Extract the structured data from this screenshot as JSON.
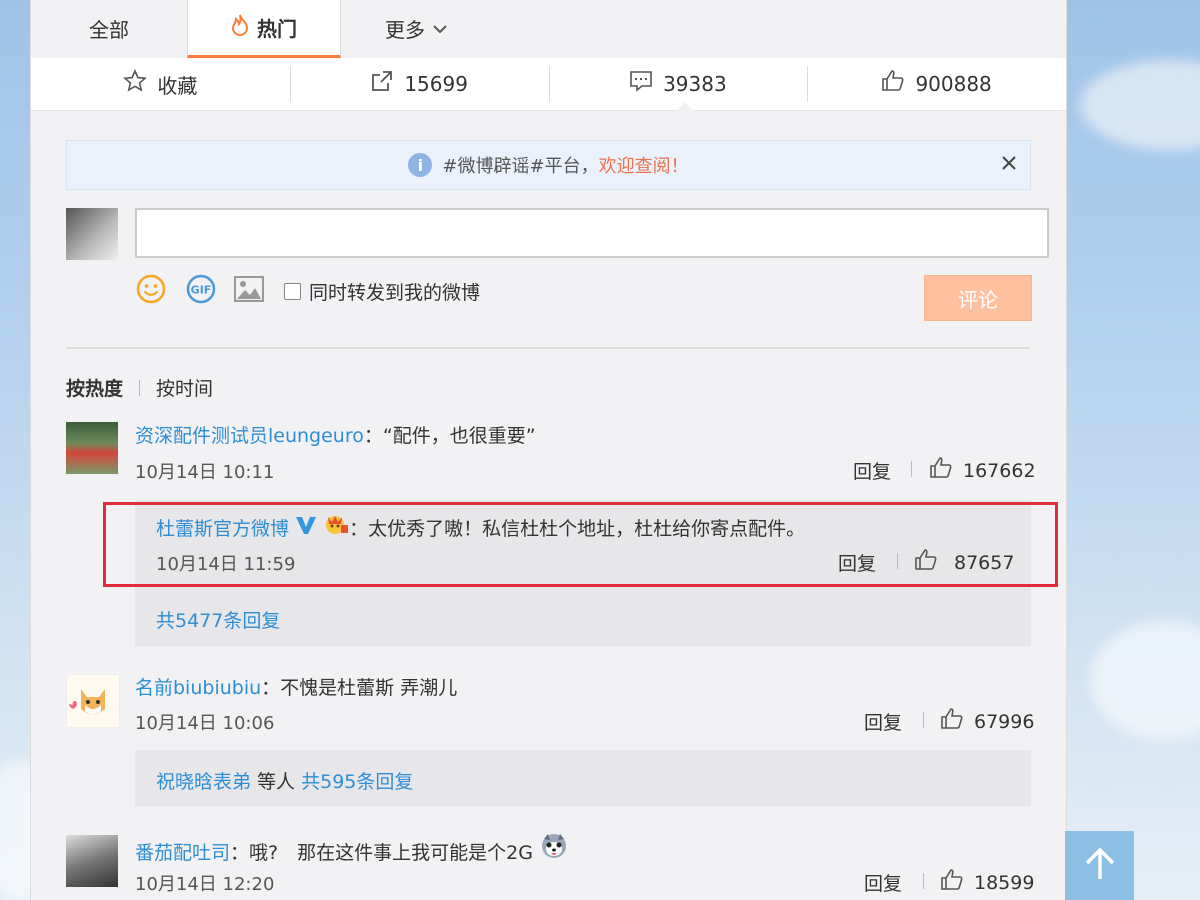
{
  "tabs": [
    {
      "label": "全部"
    },
    {
      "label": "热门"
    },
    {
      "label": "更多"
    }
  ],
  "actions": {
    "favorite_label": "收藏",
    "share_count": "15699",
    "comment_count": "39383",
    "like_count": "900888"
  },
  "notice": {
    "prefix": "#微博辟谣#平台，",
    "link": "欢迎查阅！"
  },
  "compose": {
    "placeholder": "",
    "forward_label": "同时转发到我的微博",
    "submit_label": "评论"
  },
  "sort": {
    "hot": "按热度",
    "time": "按时间"
  },
  "comments": [
    {
      "user": "资深配件测试员leungeuro",
      "text": "：“配件，也很重要”",
      "time": "10月14日 10:11",
      "reply": "回复",
      "likes": "167662",
      "replies": [
        {
          "user": "杜蕾斯官方微博",
          "text": "：太优秀了嗷！私信杜杜个地址，杜杜给你寄点配件。",
          "time": "10月14日 11:59",
          "reply": "回复",
          "likes": "87657"
        }
      ],
      "more": "共5477条回复"
    },
    {
      "user": "名前biubiubiu",
      "text": "：不愧是杜蕾斯 弄潮儿",
      "time": "10月14日 10:06",
      "reply": "回复",
      "likes": "67996",
      "more_user": "祝晓晗表弟",
      "more_mid": " 等人 ",
      "more": "共595条回复"
    },
    {
      "user": "番茄配吐司",
      "text": "：哦?　那在这件事上我可能是个2G",
      "time": "10月14日 12:20",
      "reply": "回复",
      "likes": "18599"
    }
  ],
  "colors": {
    "accent": "#fa7d3c",
    "link": "#2d8ed4",
    "highlight": "#e12d3a"
  }
}
